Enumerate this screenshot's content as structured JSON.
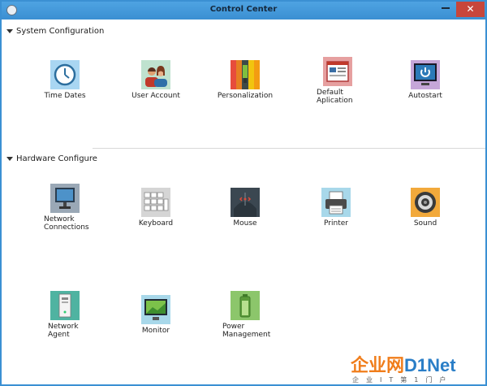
{
  "window": {
    "title": "Control Center",
    "close_glyph": "✕"
  },
  "sections": [
    {
      "header": "System Configuration",
      "items": [
        {
          "label": "Time Dates",
          "icon": "clock-icon"
        },
        {
          "label": "User Account",
          "icon": "users-icon"
        },
        {
          "label": "Personalization",
          "icon": "palette-icon"
        },
        {
          "label_lines": [
            "Default",
            "Aplication"
          ],
          "icon": "default-app-icon"
        },
        {
          "label": "Autostart",
          "icon": "power-icon"
        }
      ]
    },
    {
      "header": "Hardware Configure",
      "items": [
        {
          "label_lines": [
            "Network",
            "Connections"
          ],
          "icon": "network-icon"
        },
        {
          "label": "Keyboard",
          "icon": "keyboard-icon"
        },
        {
          "label": "Mouse",
          "icon": "mouse-icon"
        },
        {
          "label": "Printer",
          "icon": "printer-icon"
        },
        {
          "label": "Sound",
          "icon": "speaker-icon"
        },
        {
          "label_lines": [
            "Network",
            "Agent"
          ],
          "icon": "network-agent-icon"
        },
        {
          "label": "Monitor",
          "icon": "monitor-icon"
        },
        {
          "label_lines": [
            "Power",
            "Management"
          ],
          "icon": "battery-icon"
        }
      ]
    }
  ],
  "watermark": {
    "brand_cn": "企业网",
    "brand_en": "D1Net",
    "sub": "企业IT第1门户"
  },
  "colors": {
    "titlebar": "#3f95d6",
    "close": "#c7463b",
    "accent_orange": "#f07d1b",
    "accent_blue": "#2a7ec7"
  }
}
